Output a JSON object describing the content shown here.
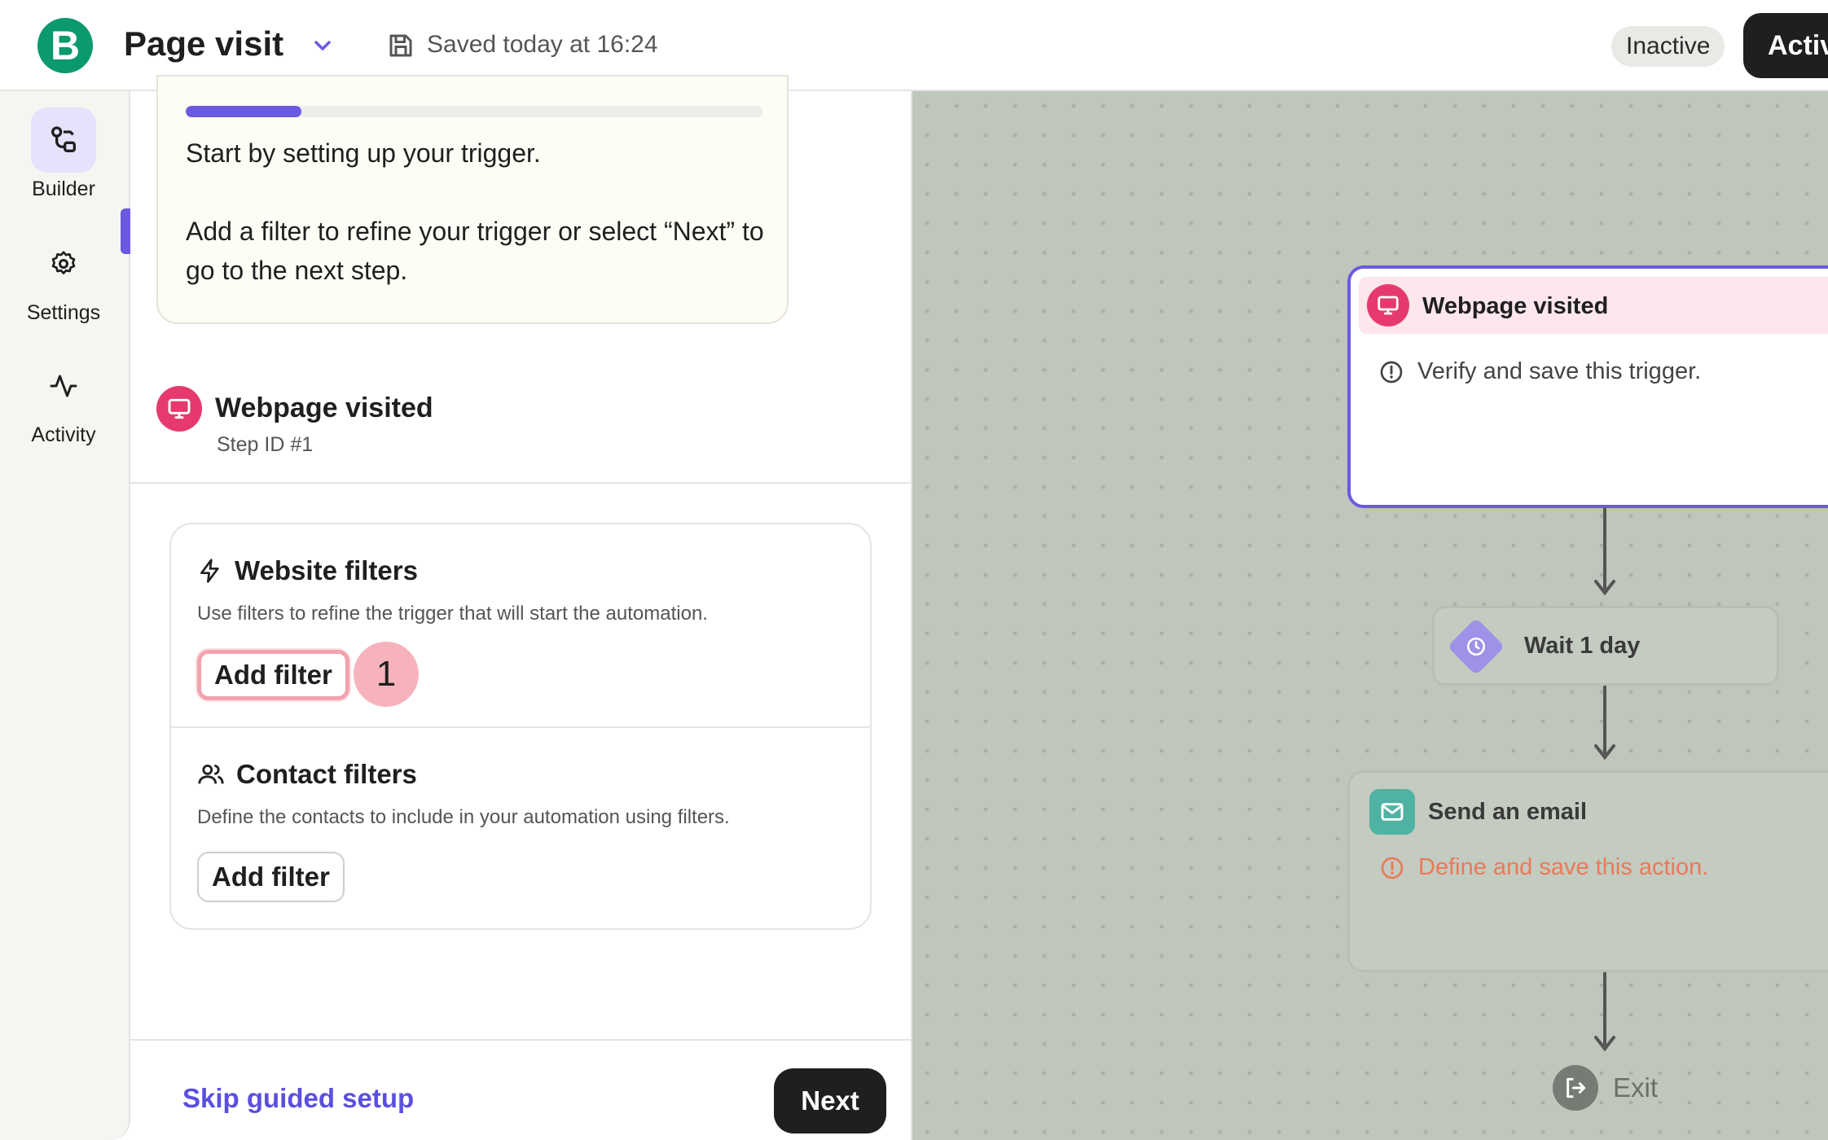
{
  "header": {
    "logo_letter": "B",
    "title": "Page visit",
    "saved_text": "Saved today at 16:24",
    "status_badge": "Inactive",
    "activate_label": "Activ"
  },
  "nav": {
    "items": [
      {
        "label": "Builder",
        "icon": "builder-icon",
        "active": true
      },
      {
        "label": "Settings",
        "icon": "gear-icon",
        "active": false
      },
      {
        "label": "Activity",
        "icon": "activity-icon",
        "active": false
      }
    ]
  },
  "guide": {
    "progress": 0.2,
    "text_1": "Start by setting up your trigger.",
    "text_2": "Add a filter to refine your trigger or select “Next” to go to the next step."
  },
  "step": {
    "title": "Webpage visited",
    "id_label": "Step ID #1"
  },
  "filters": {
    "website": {
      "title": "Website filters",
      "description": "Use filters to refine the trigger that will start the automation.",
      "button": "Add filter",
      "marker": "1"
    },
    "contact": {
      "title": "Contact filters",
      "description": "Define the contacts to include in your automation using filters.",
      "button": "Add filter"
    }
  },
  "footer": {
    "skip_label": "Skip guided setup",
    "next_label": "Next"
  },
  "canvas": {
    "trigger": {
      "title": "Webpage visited",
      "message": "Verify and save this trigger."
    },
    "wait": {
      "title": "Wait 1 day"
    },
    "email": {
      "title": "Send an email",
      "message": "Define and save this action."
    },
    "exit": {
      "label": "Exit"
    }
  },
  "colors": {
    "accent": "#6a5ae0",
    "brand": "#0b996e",
    "trigger": "#e63a6f",
    "email": "#4fb3a3",
    "warning": "#e97a5a"
  }
}
